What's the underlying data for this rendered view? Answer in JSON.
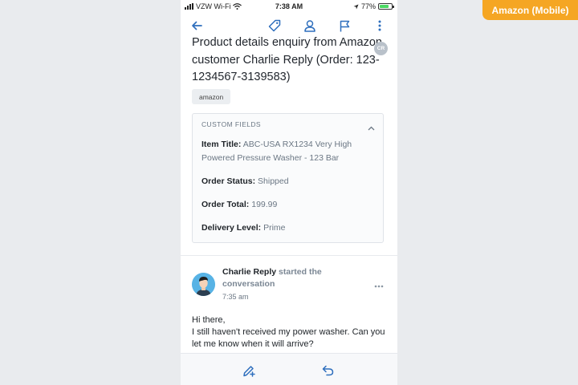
{
  "badge": "Amazon (Mobile)",
  "status_bar": {
    "carrier": "VZW Wi-Fi",
    "time": "7:38 AM",
    "battery": "77%",
    "battery_level": 0.77
  },
  "navbar": {
    "icons": [
      "back-arrow-icon",
      "tag-icon",
      "person-icon",
      "flag-icon",
      "more-vertical-icon"
    ]
  },
  "ticket": {
    "subject": "Product details enquiry from Amazon customer Charlie Reply (Order: 123-1234567-3139583)",
    "assignee_initials": "CR",
    "tag": "amazon"
  },
  "custom_fields": {
    "header": "CUSTOM FIELDS",
    "fields": [
      {
        "label": "Item Title:",
        "value": "ABC-USA RX1234 Very High Powered Pressure Washer - 123 Bar"
      },
      {
        "label": "Order Status:",
        "value": "Shipped"
      },
      {
        "label": "Order Total:",
        "value": "199.99"
      },
      {
        "label": "Delivery Level:",
        "value": "Prime"
      }
    ]
  },
  "conversation": {
    "author": "Charlie Reply",
    "action": "started the conversation",
    "time": "7:35 am",
    "greeting": "Hi there,",
    "body": "I still haven't received my power washer. Can you let me know when it will arrive?"
  },
  "bottom_bar": {
    "icons": [
      "compose-note-icon",
      "reply-icon"
    ]
  },
  "colors": {
    "badge": "#f5a623",
    "accent": "#2f6fbd",
    "avatar_bg": "#58b3e5"
  }
}
